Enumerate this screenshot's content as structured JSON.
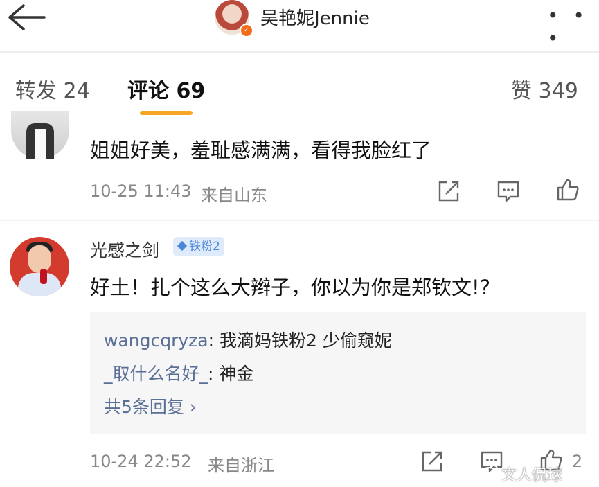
{
  "header": {
    "title": "吴艳妮Jennie",
    "more": "• • •"
  },
  "tabs": {
    "repost": "转发 24",
    "comments": "评论 69",
    "likes": "赞 349"
  },
  "comments": [
    {
      "text": "姐姐好美，羞耻感满满，看得我脸红了",
      "time": "10-25 11:43",
      "source": "来自山东"
    },
    {
      "username": "光感之剑",
      "badge": "铁粉2",
      "text": "好土！扎个这么大辫子，你以为你是郑钦文!?",
      "replies": [
        {
          "name": "wangcqryza",
          "text": ": 我滴妈铁粉2 少偷窥妮"
        },
        {
          "name": "_取什么名好_",
          "text": ": 神金"
        }
      ],
      "more_replies": "共5条回复 ›",
      "time": "10-24 22:52",
      "source": "来自浙江",
      "like_count": "2"
    }
  ],
  "watermark": "文人侃球",
  "icons": [
    "back-arrow-icon",
    "verified-icon",
    "more-icon",
    "share-icon",
    "comment-icon",
    "like-icon",
    "weibo-logo-icon"
  ],
  "colors": {
    "accent": "#f5a623",
    "badge_bg": "#dfeafb",
    "badge_text": "#4a87d8",
    "verified": "#f26d1a"
  }
}
